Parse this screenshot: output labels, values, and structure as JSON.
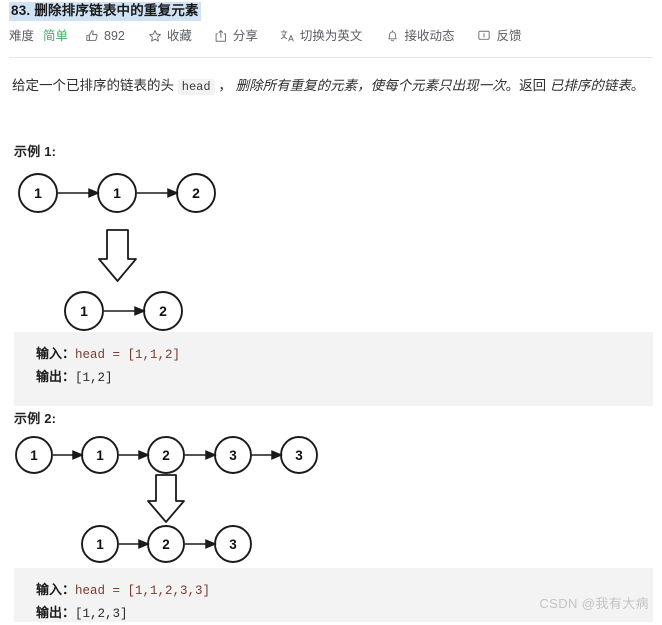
{
  "header": {
    "title": "83. 删除排序链表中的重复元素",
    "toolbar": [
      {
        "name": "difficulty",
        "icon": null,
        "label": "难度",
        "value": "简单",
        "value_color": "#3faf61"
      },
      {
        "name": "votes",
        "icon": "thumbs-up-icon",
        "label": "892"
      },
      {
        "name": "favorite",
        "icon": "star-icon",
        "label": "收藏"
      },
      {
        "name": "share",
        "icon": "share-icon",
        "label": "分享"
      },
      {
        "name": "switch-language",
        "icon": "translate-icon",
        "label": "切换为英文"
      },
      {
        "name": "notifications",
        "icon": "bell-icon",
        "label": "接收动态"
      },
      {
        "name": "feedback",
        "icon": "feedback-icon",
        "label": "反馈"
      }
    ]
  },
  "description": {
    "part1": "给定一个已排序的链表的头 ",
    "code": "head",
    "part2": " ， ",
    "em1": "删除所有重复的元素，使每个元素只出现一次",
    "part3": "。返回 ",
    "em2": "已排序的链表",
    "part4": "。"
  },
  "examples": [
    {
      "heading": "示例 1:",
      "input_label": "输入：",
      "input_value": "head = [1,1,2]",
      "output_label": "输出：",
      "output_value": "[1,2]",
      "before_nodes": [
        "1",
        "1",
        "2"
      ],
      "after_nodes": [
        "1",
        "2"
      ]
    },
    {
      "heading": "示例 2:",
      "input_label": "输入：",
      "input_value": "head = [1,1,2,3,3]",
      "output_label": "输出：",
      "output_value": "[1,2,3]",
      "before_nodes": [
        "1",
        "1",
        "2",
        "3",
        "3"
      ],
      "after_nodes": [
        "1",
        "2",
        "3"
      ]
    }
  ],
  "watermark": "CSDN @我有大病",
  "colors": {
    "accent_easy": "#3faf61",
    "code_bg": "#f3f3f4",
    "title_highlight": "#cfe3f5",
    "divider": "#e3e5e8",
    "watermark": "#c2c4c7"
  }
}
